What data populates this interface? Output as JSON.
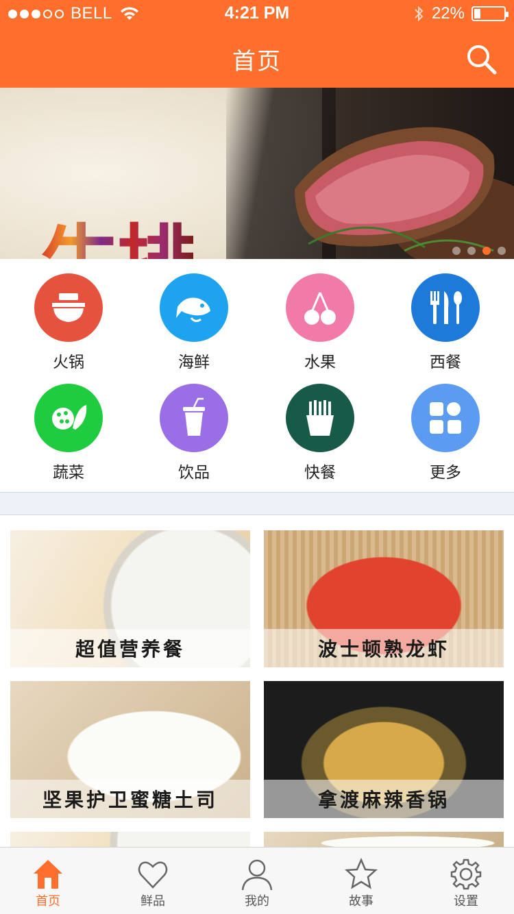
{
  "status_bar": {
    "carrier": "BELL",
    "time": "4:21 PM",
    "battery": "22%",
    "battery_level": 0.22
  },
  "header": {
    "title": "首页"
  },
  "banner": {
    "title": "牛排",
    "pages": 4,
    "active_page": 3
  },
  "categories": [
    {
      "label": "火锅",
      "icon": "hotpot-icon",
      "color": "#e5523d"
    },
    {
      "label": "海鲜",
      "icon": "fish-icon",
      "color": "#1da3f0"
    },
    {
      "label": "水果",
      "icon": "cherry-icon",
      "color": "#f27aa8"
    },
    {
      "label": "西餐",
      "icon": "cutlery-icon",
      "color": "#1e7ad9"
    },
    {
      "label": "蔬菜",
      "icon": "vegetable-icon",
      "color": "#1fcc3f"
    },
    {
      "label": "饮品",
      "icon": "drink-icon",
      "color": "#9a6ee6"
    },
    {
      "label": "快餐",
      "icon": "fries-icon",
      "color": "#165a47"
    },
    {
      "label": "更多",
      "icon": "grid-icon",
      "color": "#5b9cf2"
    }
  ],
  "cards": [
    {
      "title": "超值营养餐"
    },
    {
      "title": "波士顿熟龙虾"
    },
    {
      "title": "坚果护卫蜜糖土司"
    },
    {
      "title": "拿渡麻辣香锅"
    }
  ],
  "tabbar": [
    {
      "label": "首页",
      "icon": "home-icon",
      "active": true
    },
    {
      "label": "鲜品",
      "icon": "heart-icon",
      "active": false
    },
    {
      "label": "我的",
      "icon": "user-icon",
      "active": false
    },
    {
      "label": "故事",
      "icon": "star-icon",
      "active": false
    },
    {
      "label": "设置",
      "icon": "gear-icon",
      "active": false
    }
  ],
  "colors": {
    "accent": "#ff6f2c",
    "separator": "#eef1f7"
  }
}
